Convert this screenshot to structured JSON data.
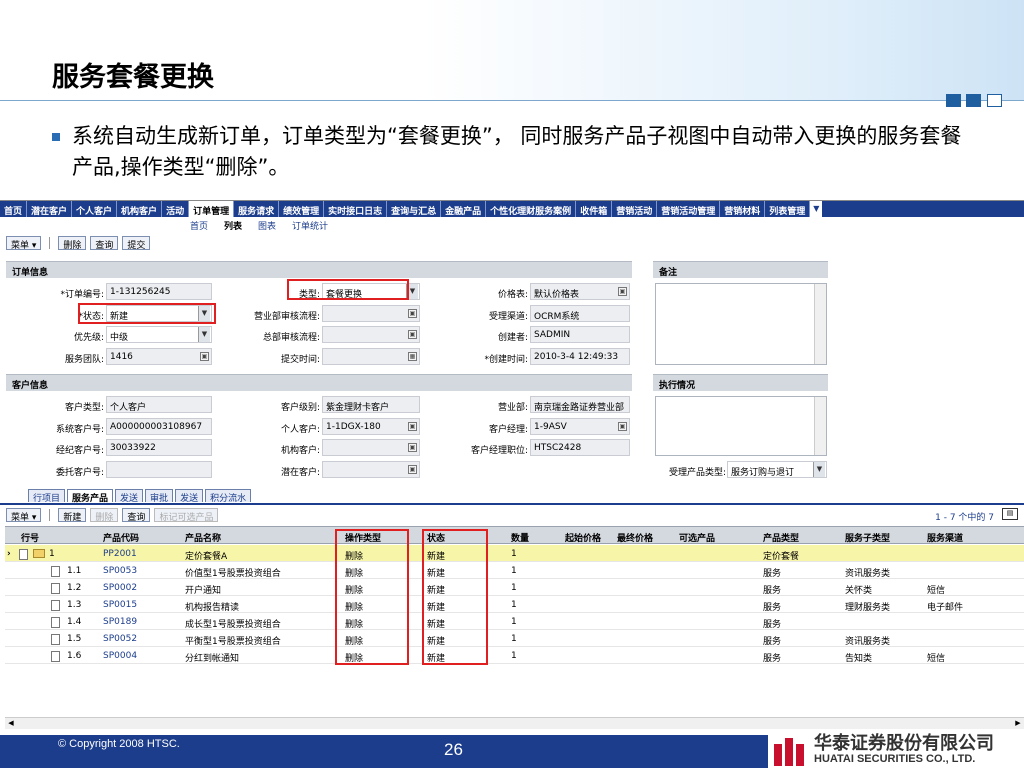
{
  "slide": {
    "title": "服务套餐更换",
    "bullet": "系统自动生成新订单，订单类型为“套餐更换”， 同时服务产品子视图中自动带入更换的服务套餐产品,操作类型“删除”。",
    "copyright": "© Copyright 2008 HTSC.",
    "page_number": "26",
    "logo_cn": "华泰证券股份有限公司",
    "logo_en": "HUATAI SECURITIES CO., LTD."
  },
  "nav": {
    "items": [
      "首页",
      "潜在客户",
      "个人客户",
      "机构客户",
      "活动",
      "订单管理",
      "服务请求",
      "绩效管理",
      "实时接口日志",
      "查询与汇总",
      "金融产品",
      "个性化理财服务案例",
      "收件箱",
      "营销活动",
      "营销活动管理",
      "营销材料",
      "列表管理"
    ],
    "active": "订单管理",
    "dropdown": "▼"
  },
  "subnav": [
    "首页",
    "列表",
    "图表",
    "订单统计"
  ],
  "subnav_active": "列表",
  "toolbar": {
    "menu": "菜单 ▾",
    "delete": "删除",
    "query": "查询",
    "submit": "提交"
  },
  "order": {
    "section": "订单信息",
    "order_no_label": "*订单编号:",
    "order_no": "1-131256245",
    "status_label": "*状态:",
    "status": "新建",
    "priority_label": "优先级:",
    "priority": "中级",
    "team_label": "服务团队:",
    "team": "1416",
    "type_label": "类型:",
    "type": "套餐更换",
    "dept_flow_label": "营业部审核流程:",
    "dept_flow": "",
    "hq_flow_label": "总部审核流程:",
    "hq_flow": "",
    "submit_time_label": "提交时间:",
    "submit_time": "",
    "pricelist_label": "价格表:",
    "pricelist": "默认价格表",
    "channel_label": "受理渠道:",
    "channel": "OCRM系统",
    "creator_label": "创建者:",
    "creator": "SADMIN",
    "created_label": "*创建时间:",
    "created": "2010-3-4 12:49:33"
  },
  "remarks": {
    "label": "备注"
  },
  "execution": {
    "label": "执行情况"
  },
  "product_type_label": "受理产品类型:",
  "product_type": "服务订购与退订",
  "customer": {
    "section": "客户信息",
    "type_label": "客户类型:",
    "type": "个人客户",
    "sys_no_label": "系统客户号:",
    "sys_no": "A000000003108967",
    "broker_no_label": "经纪客户号:",
    "broker_no": "30033922",
    "entrust_no_label": "委托客户号:",
    "entrust_no": "",
    "level_label": "客户级别:",
    "level": "紫金理财卡客户",
    "personal_label": "个人客户:",
    "personal": "1-1DGX-180",
    "org_label": "机构客户:",
    "org": "",
    "potential_label": "潜在客户:",
    "potential": "",
    "branch_label": "营业部:",
    "branch": "南京瑞金路证券营业部",
    "manager_label": "客户经理:",
    "manager": "1-9ASV",
    "manager_pos_label": "客户经理职位:",
    "manager_pos": "HTSC2428"
  },
  "tabs": [
    "行项目",
    "服务产品",
    "发送",
    "审批",
    "发送",
    "积分流水"
  ],
  "tabs_active": "服务产品",
  "list_toolbar": {
    "menu": "菜单 ▾",
    "new": "新建",
    "delete": "删除",
    "query": "查询",
    "mark": "标记可选产品",
    "paging": "1 - 7 个中的 7"
  },
  "table": {
    "headers": [
      "行号",
      "产品代码",
      "产品名称",
      "操作类型",
      "状态",
      "数量",
      "起始价格",
      "最终价格",
      "可选产品",
      "产品类型",
      "服务子类型",
      "服务渠道"
    ],
    "rows": [
      {
        "no": "1",
        "code": "PP2001",
        "name": "定价套餐A",
        "op": "删除",
        "status": "新建",
        "qty": "1",
        "ptype": "定价套餐",
        "subtype": "",
        "channel": ""
      },
      {
        "no": "1.1",
        "code": "SP0053",
        "name": "价值型1号股票投资组合",
        "op": "删除",
        "status": "新建",
        "qty": "1",
        "ptype": "服务",
        "subtype": "资讯服务类",
        "channel": ""
      },
      {
        "no": "1.2",
        "code": "SP0002",
        "name": "开户通知",
        "op": "删除",
        "status": "新建",
        "qty": "1",
        "ptype": "服务",
        "subtype": "关怀类",
        "channel": "短信"
      },
      {
        "no": "1.3",
        "code": "SP0015",
        "name": "机构报告精读",
        "op": "删除",
        "status": "新建",
        "qty": "1",
        "ptype": "服务",
        "subtype": "理财服务类",
        "channel": "电子邮件"
      },
      {
        "no": "1.4",
        "code": "SP0189",
        "name": "成长型1号股票投资组合",
        "op": "删除",
        "status": "新建",
        "qty": "1",
        "ptype": "服务",
        "subtype": "",
        "channel": ""
      },
      {
        "no": "1.5",
        "code": "SP0052",
        "name": "平衡型1号股票投资组合",
        "op": "删除",
        "status": "新建",
        "qty": "1",
        "ptype": "服务",
        "subtype": "资讯服务类",
        "channel": ""
      },
      {
        "no": "1.6",
        "code": "SP0004",
        "name": "分红到帐通知",
        "op": "删除",
        "status": "新建",
        "qty": "1",
        "ptype": "服务",
        "subtype": "告知类",
        "channel": "短信"
      }
    ]
  },
  "colors": {
    "nav": "#1c3d8c",
    "highlight": "#e02020",
    "selected_row": "#f7f5a8"
  }
}
